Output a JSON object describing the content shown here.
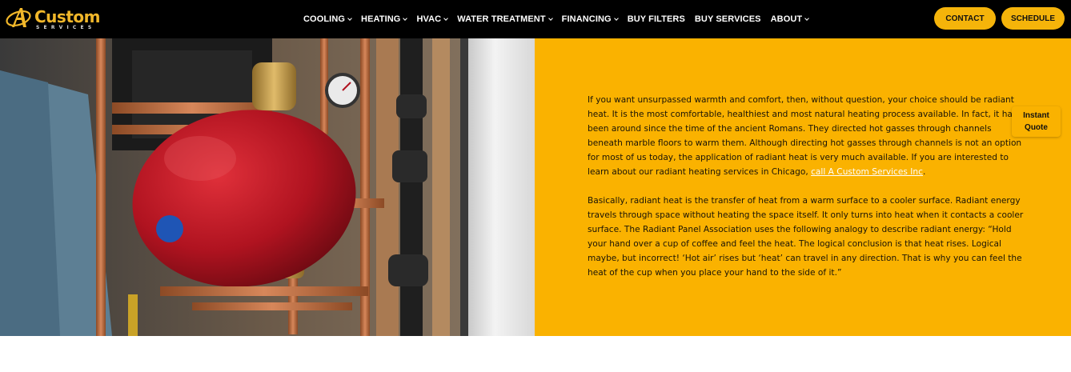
{
  "brand": {
    "name": "Custom",
    "tagline": "SERVICES",
    "gold": "#f1b72a",
    "accent": "#fab200"
  },
  "nav": {
    "items": [
      {
        "label": "COOLING",
        "dropdown": true
      },
      {
        "label": "HEATING",
        "dropdown": true
      },
      {
        "label": "HVAC",
        "dropdown": true
      },
      {
        "label": "WATER TREATMENT",
        "dropdown": true
      },
      {
        "label": "FINANCING",
        "dropdown": true
      },
      {
        "label": "BUY FILTERS",
        "dropdown": false
      },
      {
        "label": "BUY SERVICES",
        "dropdown": false
      },
      {
        "label": "ABOUT",
        "dropdown": true
      }
    ],
    "contact_label": "CONTACT",
    "schedule_label": "SCHEDULE"
  },
  "content": {
    "p1_before_link": "If you want unsurpassed warmth and comfort, then, without question, your choice should be radiant heat. It is the most comfortable, healthiest and most natural heating process available. In fact, it has been around since the time of the ancient Romans. They directed hot gasses through channels beneath marble floors to warm them. Although directing hot gasses through channels is not an option for most of us today, the application of radiant heat is very much available. If you are interested to learn about our radiant heating services in Chicago, ",
    "p1_link": "call A Custom Services Inc",
    "p1_after_link": ".",
    "p2": "Basically, radiant heat is the transfer of heat from a warm surface to a cooler surface. Radiant energy travels through space without heating the space itself. It only turns into heat when it contacts a cooler surface. The Radiant Panel Association uses the following analogy to describe radiant energy: “Hold your hand over a cup of coffee and feel the heat. The logical conclusion is that heat rises. Logical maybe, but incorrect! ‘Hot air’ rises but ‘heat’ can travel in any direction. That is why you can feel the heat of the cup when you place your hand to the side of it.”"
  },
  "instant_quote": {
    "line1": "Instant",
    "line2": "Quote"
  }
}
